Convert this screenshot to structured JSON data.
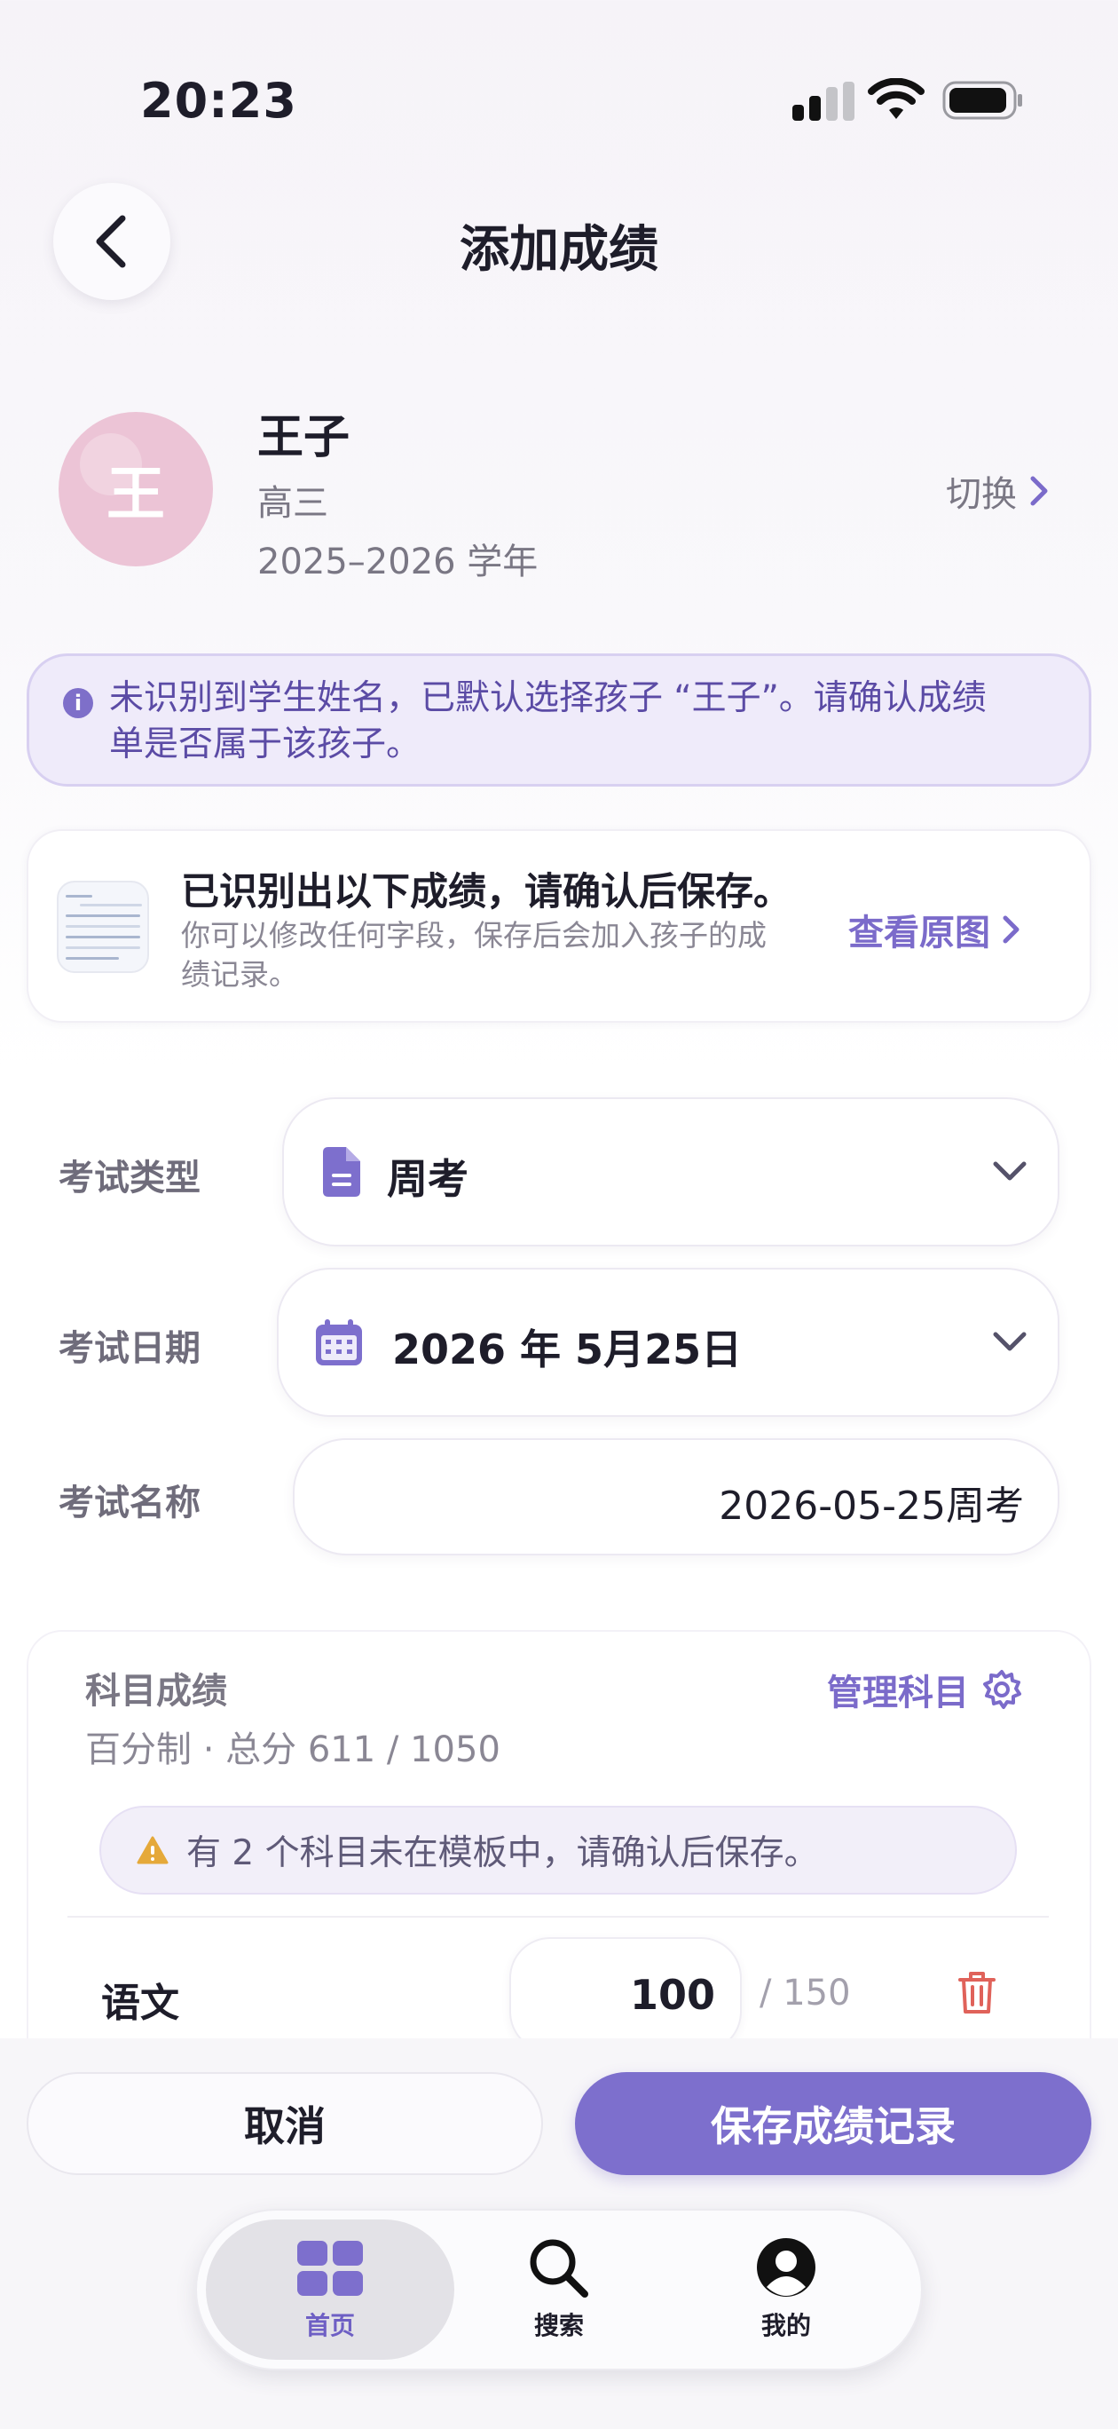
{
  "status_bar": {
    "time": "20:23"
  },
  "header": {
    "title": "添加成绩",
    "back_icon": "chevron-left-icon"
  },
  "student": {
    "avatar_initial": "王",
    "name": "王子",
    "grade": "高三",
    "school_year": "2025–2026 学年",
    "switch_label": "切换",
    "avatar_color": "#ecc4d6"
  },
  "notice": {
    "icon": "info-icon",
    "text_line1": "未识别到学生姓名，已默认选择孩子 “王子”。请确认成绩",
    "text_line2": "单是否属于该孩子。"
  },
  "recognition": {
    "title": "已识别出以下成绩，请确认后保存。",
    "desc_line1": "你可以修改任何字段，保存后会加入孩子的成",
    "desc_line2": "绩记录。",
    "view_original_label": "查看原图"
  },
  "form": {
    "exam_type": {
      "label": "考试类型",
      "value": "周考",
      "icon": "document-icon"
    },
    "exam_date": {
      "label": "考试日期",
      "value": "2026 年 5月25日",
      "icon": "calendar-icon"
    },
    "exam_name": {
      "label": "考试名称",
      "value": "2026-05-25周考"
    }
  },
  "subjects": {
    "title": "科目成绩",
    "meta": "百分制 · 总分 611 / 1050",
    "manage_label": "管理科目",
    "warning": "有 2 个科目未在模板中，请确认后保存。",
    "rows": [
      {
        "name": "语文",
        "score": "100",
        "max": "/ 150"
      }
    ]
  },
  "actions": {
    "cancel_label": "取消",
    "save_label": "保存成绩记录"
  },
  "tabbar": {
    "tabs": [
      {
        "label": "首页",
        "icon": "grid-icon",
        "active": true
      },
      {
        "label": "搜索",
        "icon": "search-icon",
        "active": false
      },
      {
        "label": "我的",
        "icon": "profile-icon",
        "active": false
      }
    ]
  },
  "colors": {
    "accent": "#7d6fcd",
    "danger": "#e0625a",
    "warning": "#e5a93a"
  }
}
